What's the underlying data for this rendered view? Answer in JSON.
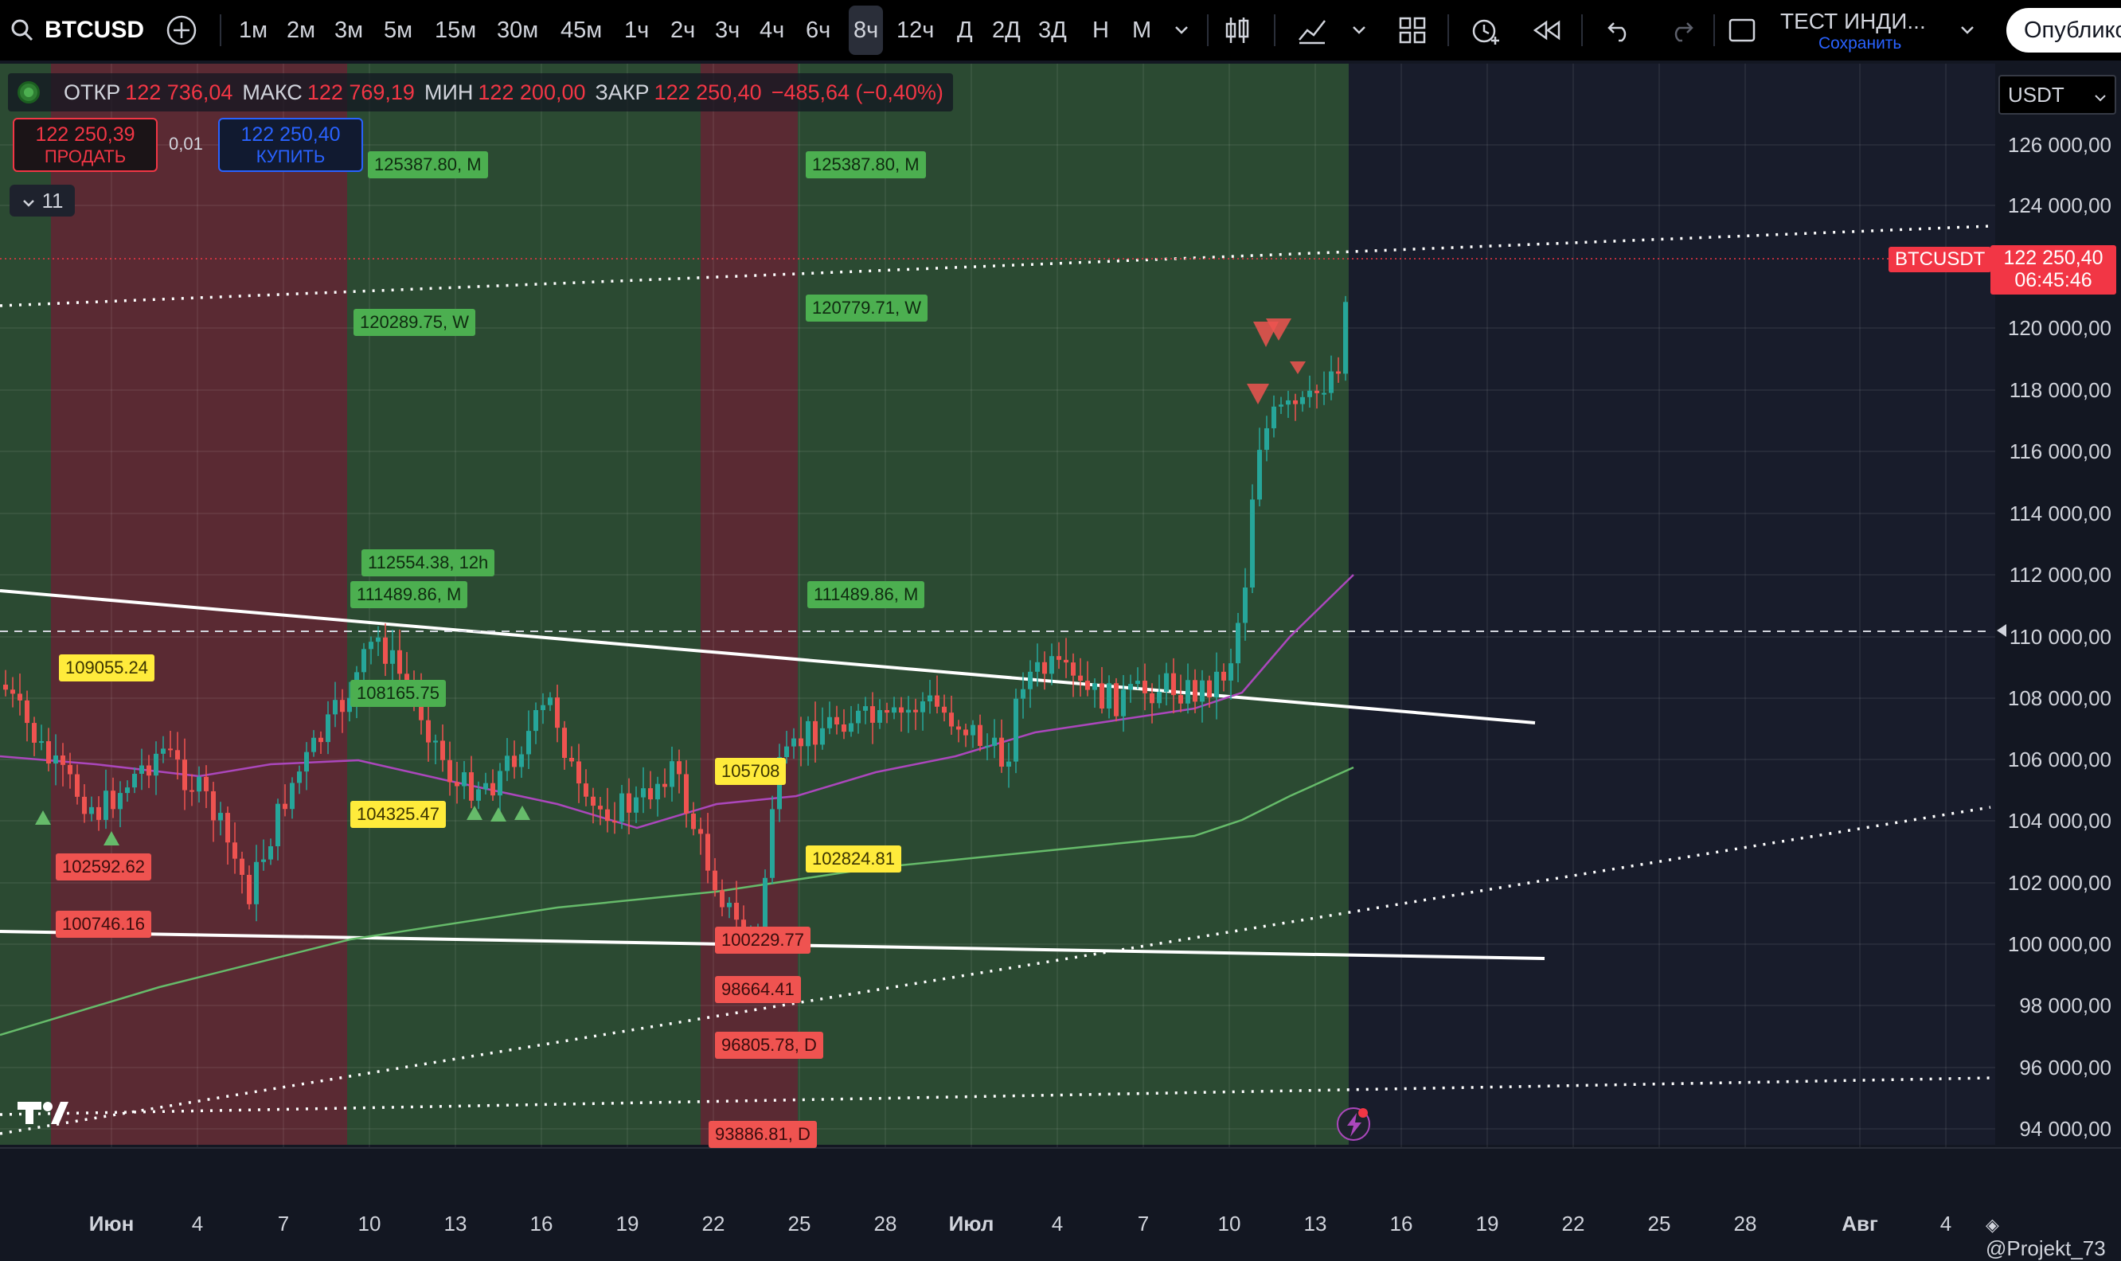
{
  "toolbar": {
    "symbol": "BTCUSD",
    "timeframes": [
      "1м",
      "2м",
      "3м",
      "5м",
      "15м",
      "30м",
      "45м",
      "1ч",
      "2ч",
      "3ч",
      "4ч",
      "6ч",
      "8ч",
      "12ч",
      "Д",
      "2Д",
      "3Д",
      "Н",
      "М"
    ],
    "active_timeframe": "8ч",
    "layout_title": "ТЕСТ ИНДИ...",
    "save_label": "Сохранить",
    "publish_label": "Опублико"
  },
  "ohlc": {
    "open_label": "ОТКР",
    "open": "122 736,04",
    "high_label": "МАКС",
    "high": "122 769,19",
    "low_label": "МИН",
    "low": "122 200,00",
    "close_label": "ЗАКР",
    "close": "122 250,40",
    "change": "−485,64 (−0,40%)"
  },
  "trade": {
    "sell_price": "122 250,39",
    "sell_label": "ПРОДАТЬ",
    "buy_price": "122 250,40",
    "buy_label": "КУПИТЬ",
    "spread": "0,01"
  },
  "indicators_count": "11",
  "currency": "USDT",
  "price_axis": [
    "126 000,00",
    "124 000,00",
    "120 000,00",
    "118 000,00",
    "116 000,00",
    "114 000,00",
    "112 000,00",
    "110 000,00",
    "108 000,00",
    "106 000,00",
    "104 000,00",
    "102 000,00",
    "100 000,00",
    "98 000,00",
    "96 000,00",
    "94 000,00"
  ],
  "time_axis": [
    "Июн",
    "4",
    "7",
    "10",
    "13",
    "16",
    "19",
    "22",
    "25",
    "28",
    "Июл",
    "4",
    "7",
    "10",
    "13",
    "16",
    "19",
    "22",
    "25",
    "28",
    "Авг",
    "4"
  ],
  "last_price": {
    "symbol": "BTCUSDT",
    "price": "122 250,40",
    "countdown": "06:45:46"
  },
  "levels": [
    {
      "text": "125387.80, M",
      "color": "g"
    },
    {
      "text": "125387.80, M",
      "color": "g"
    },
    {
      "text": "120289.75, W",
      "color": "g"
    },
    {
      "text": "120779.71, W",
      "color": "g"
    },
    {
      "text": "112554.38, 12h",
      "color": "g"
    },
    {
      "text": "111489.86, M",
      "color": "g"
    },
    {
      "text": "111489.86, M",
      "color": "g"
    },
    {
      "text": "109055.24",
      "color": "y"
    },
    {
      "text": "108165.75",
      "color": "g"
    },
    {
      "text": "104325.47",
      "color": "y"
    },
    {
      "text": "102592.62",
      "color": "r"
    },
    {
      "text": "100746.16",
      "color": "r"
    },
    {
      "text": "105708",
      "color": "y"
    },
    {
      "text": "102824.81",
      "color": "y"
    },
    {
      "text": "98664.41",
      "color": "r"
    },
    {
      "text": "96805.78, D",
      "color": "r"
    },
    {
      "text": "93886.81, D",
      "color": "r"
    },
    {
      "text": "100229.77",
      "color": "r"
    }
  ],
  "brand": "@Projekt_73",
  "colors": {
    "up": "#26a69a",
    "down": "#ef5350",
    "bg": "#131722",
    "green_zone": "#2b4a32",
    "red_zone": "#5a2a33"
  }
}
